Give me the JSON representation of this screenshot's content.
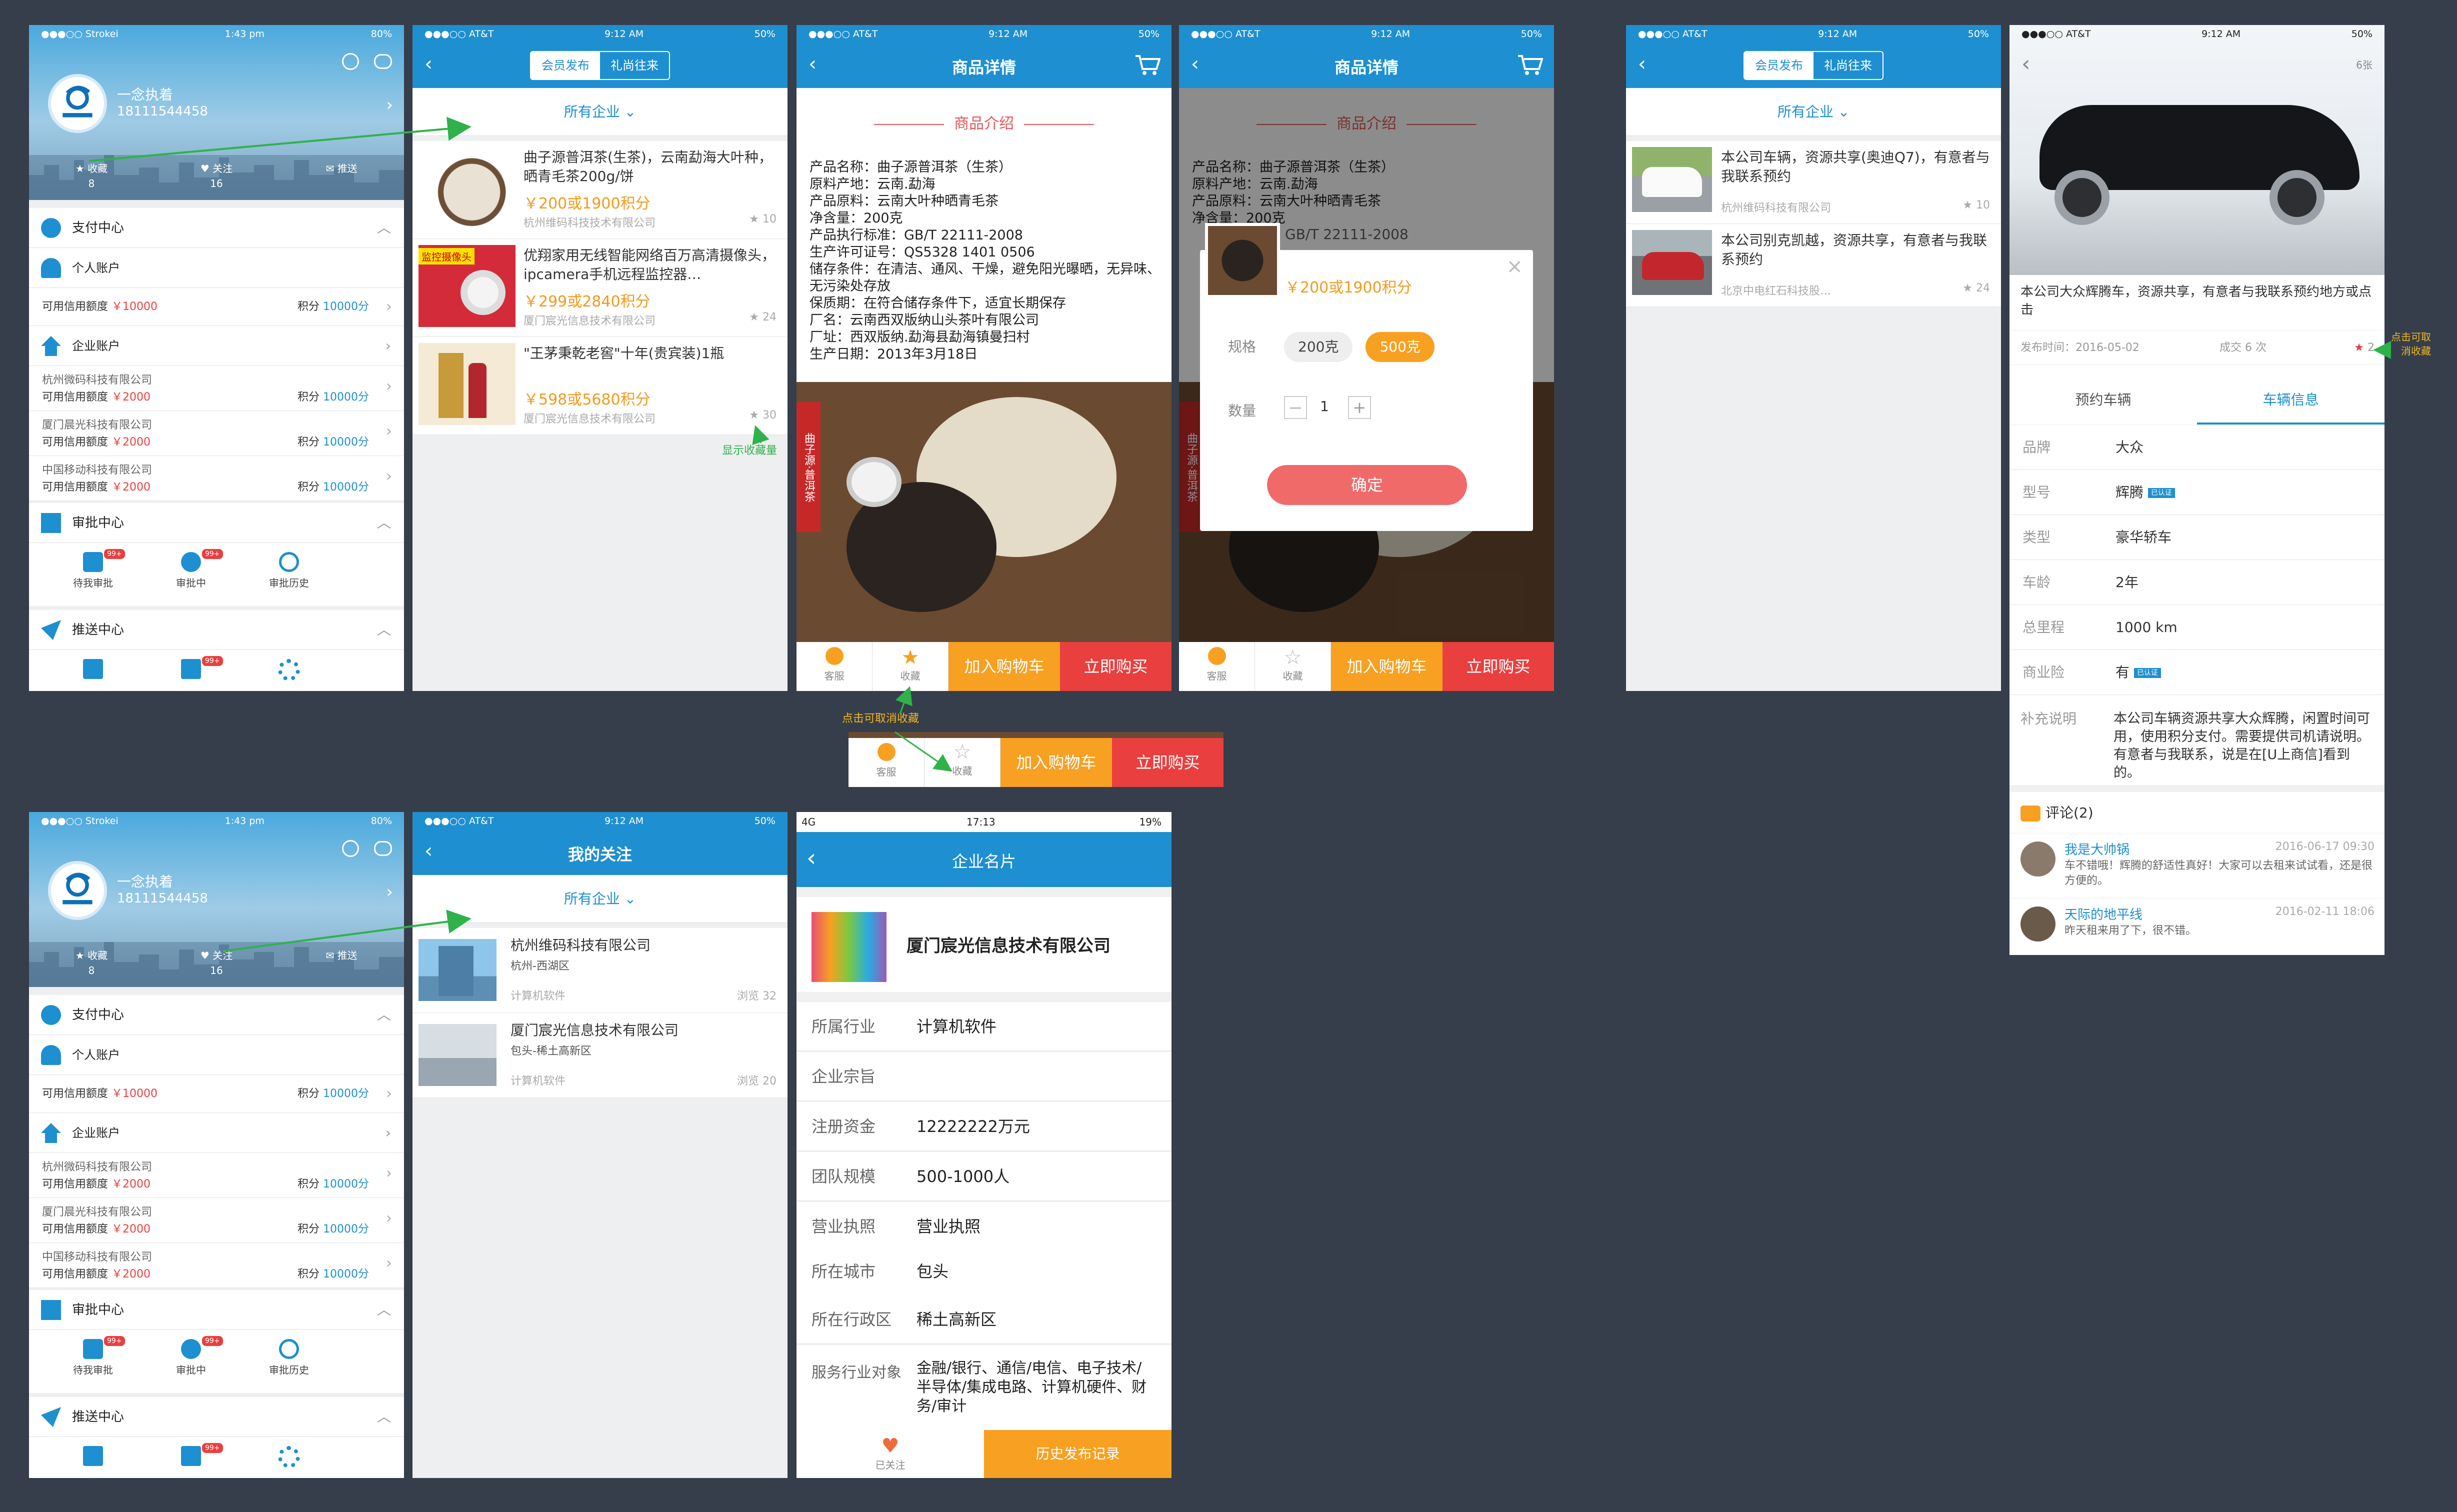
{
  "profile": {
    "status": {
      "carrier": "●●●○○ Strokei",
      "time": "1:43 pm",
      "battery": "80%"
    },
    "user_name": "一念执着",
    "phone": "18111544458",
    "stats": [
      {
        "label": "收藏",
        "value": "8"
      },
      {
        "label": "关注",
        "value": "16"
      },
      {
        "label": "推送",
        "value": ""
      }
    ],
    "pay_center": "支付中心",
    "personal_account": "个人账户",
    "credit_label": "可用信用额度",
    "credit_personal": "￥10000",
    "points_label": "积分",
    "points_value": "10000分",
    "enterprise_account": "企业账户",
    "companies": [
      {
        "name": "杭州微码科技有限公司",
        "credit": "￥2000"
      },
      {
        "name": "厦门晨光科技有限公司",
        "credit": "￥2000"
      },
      {
        "name": "中国移动科技有限公司",
        "credit": "￥2000"
      }
    ],
    "approval_center": "审批中心",
    "approval_items": [
      {
        "label": "待我审批",
        "badge": "99+"
      },
      {
        "label": "审批中",
        "badge": "99+"
      },
      {
        "label": "审批历史",
        "badge": ""
      }
    ],
    "push_center": "推送中心",
    "push_badge": "99+"
  },
  "list": {
    "status": {
      "carrier": "●●●○○ AT&T",
      "time": "9:12 AM",
      "battery": "50%"
    },
    "seg": [
      "会员发布",
      "礼尚往来"
    ],
    "filter": "所有企业 ⌄",
    "items": [
      {
        "title": "曲子源普洱茶(生茶)，云南勐海大叶种，晒青毛茶200g/饼",
        "price": "￥200或1900积分",
        "company": "杭州维码科技技术有限公司",
        "stars": "10"
      },
      {
        "title": "优翔家用无线智能网络百万高清摄像头，ipcamera手机远程监控器…",
        "price": "￥299或2840积分",
        "company": "厦门宸光信息技术有限公司",
        "stars": "24"
      },
      {
        "title": "\"王茅秉乾老窖\"十年(贵宾装)1瓶",
        "price": "￥598或5680积分",
        "company": "厦门宸光信息技术有限公司",
        "stars": "30"
      }
    ],
    "camera_tag": "监控摄像头"
  },
  "detail": {
    "title": "商品详情",
    "section": "商品介绍",
    "spec": "产品名称：曲子源普洱茶（生茶）\n原料产地：云南.勐海\n产品原料：云南大叶种晒青毛茶\n净含量：200克\n产品执行标准：GB/T 22111-2008\n生产许可证号：QS5328 1401 0506\n储存条件：在清洁、通风、干燥，避免阳光曝晒，无异味、无污染处存放\n保质期：在符合储存条件下，适宜长期保存\n厂名：云南西双版纳山头茶叶有限公司\n厂址：西双版纳.勐海县勐海镇曼扫村\n生产日期：2013年3月18日",
    "spec_short": "产品名称：曲子源普洱茶（生茶）\n原料产地：云南.勐海\n产品原料：云南大叶种晒青毛茶\n净含量：200克",
    "side_label": "曲子源·普洱茶",
    "bar": {
      "service": "客服",
      "fav": "收藏",
      "add_cart": "加入购物车",
      "buy": "立即购买"
    },
    "modal": {
      "price": "￥200或1900积分",
      "std": "GB/T 22111-2008",
      "spec_label": "规格",
      "options": [
        "200克",
        "500克"
      ],
      "qty_label": "数量",
      "qty": "1",
      "minus": "—",
      "plus": "+",
      "confirm": "确定",
      "close": "×"
    }
  },
  "car_list": {
    "items": [
      {
        "title": "本公司车辆，资源共享(奥迪Q7)，有意者与我联系预约",
        "company": "杭州维码科技有限公司",
        "stars": "10"
      },
      {
        "title": "本公司别克凯越，资源共享，有意者与我联系预约",
        "company": "北京中电红石科技股…",
        "stars": "24"
      }
    ]
  },
  "car_detail": {
    "photo_count": "6张",
    "desc": "本公司大众辉腾车，资源共享，有意者与我联系预约地方或点击",
    "publish": "发布时间：2016-05-02",
    "deals": "成交 6 次",
    "fav_count": "2",
    "tabs": [
      "预约车辆",
      "车辆信息"
    ],
    "rows": [
      {
        "k": "品牌",
        "v": "大众",
        "tag": ""
      },
      {
        "k": "型号",
        "v": "辉腾",
        "tag": "已认证"
      },
      {
        "k": "类型",
        "v": "豪华轿车",
        "tag": ""
      },
      {
        "k": "车龄",
        "v": "2年",
        "tag": ""
      },
      {
        "k": "总里程",
        "v": "1000 km",
        "tag": ""
      },
      {
        "k": "商业险",
        "v": "有",
        "tag": "已认证"
      }
    ],
    "note_k": "补充说明",
    "note_v": "本公司车辆资源共享大众辉腾，闲置时间可用，使用积分支付。需要提供司机请说明。有意者与我联系，说是在[U上商信]看到的。",
    "comments_title": "评论(2)",
    "comments": [
      {
        "name": "我是大帅锅",
        "time": "2016-06-17  09:30",
        "text": "车不错哦！辉腾的舒适性真好！大家可以去租来试试看，还是很方便的。"
      },
      {
        "name": "天际的地平线",
        "time": "2016-02-11  18:06",
        "text": "昨天租来用了下，很不错。"
      }
    ]
  },
  "follow": {
    "title": "我的关注",
    "items": [
      {
        "name": "杭州维码科技有限公司",
        "area": "杭州-西湖区",
        "industry": "计算机软件",
        "views": "浏览 32"
      },
      {
        "name": "厦门宸光信息技术有限公司",
        "area": "包头-稀土高新区",
        "industry": "计算机软件",
        "views": "浏览 20"
      }
    ]
  },
  "company": {
    "status": {
      "signal": "4G",
      "time": "17:13",
      "battery": "19%"
    },
    "title": "企业名片",
    "name": "厦门宸光信息技术有限公司",
    "rows": [
      {
        "k": "所属行业",
        "v": "计算机软件"
      },
      {
        "k": "企业宗旨",
        "v": ""
      },
      {
        "k": "注册资金",
        "v": "12222222万元"
      },
      {
        "k": "团队规模",
        "v": "500-1000人"
      },
      {
        "k": "营业执照",
        "v": "营业执照"
      },
      {
        "k": "所在城市",
        "v": "包头"
      },
      {
        "k": "所在行政区",
        "v": "稀土高新区"
      }
    ],
    "service_k": "服务行业对象",
    "service_v": "金融/银行、通信/电信、电子技术/半导体/集成电路、计算机硬件、财务/审计",
    "followed": "已关注",
    "history": "历史发布记录"
  },
  "annotations": {
    "show_fav": "显示收藏量",
    "cancel_fav": "点击可取消收藏",
    "cancel_fav2a": "点击可取",
    "cancel_fav2b": "消收藏"
  },
  "colors": {
    "primary": "#1e8fd0",
    "orange": "#f7a021",
    "red": "#e93f3f",
    "price": "#f39a1c",
    "bg": "#363d4b",
    "arrow": "#2fb24a"
  }
}
